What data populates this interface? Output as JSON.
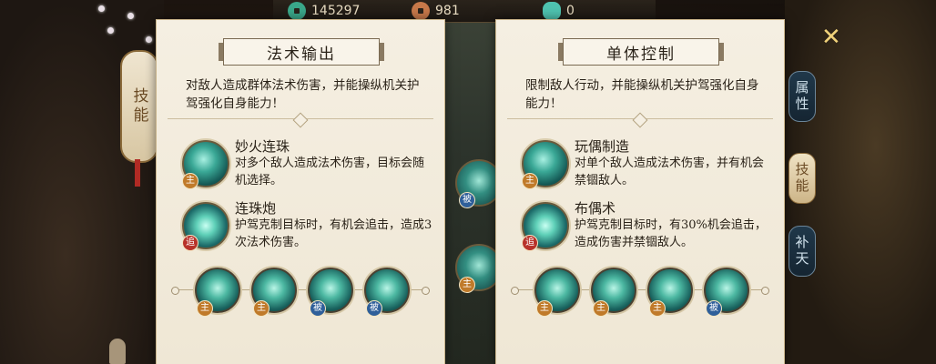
{
  "resources": [
    {
      "icon": "jade-coin-icon",
      "value": "145297",
      "color": "#3aa88a"
    },
    {
      "icon": "copper-coin-icon",
      "value": "981",
      "color": "#c8794a"
    },
    {
      "icon": "gem-icon",
      "value": "0",
      "color": "#4fc3b0"
    }
  ],
  "left_tab_label": "技能",
  "panels": [
    {
      "title": "法术输出",
      "description": "对敌人造成群体法术伤害，并能操纵机关护驾强化自身能力！",
      "skills": [
        {
          "name": "妙火连珠",
          "badge": "主",
          "desc": "对多个敌人造成法术伤害，目标会随机选择。"
        },
        {
          "name": "连珠炮",
          "badge": "追",
          "desc": "护驾克制目标时，有机会追击，造成3次法术伤害。"
        }
      ],
      "bottom_badges": [
        "主",
        "主",
        "被",
        "被"
      ]
    },
    {
      "title": "单体控制",
      "description": "限制敌人行动，并能操纵机关护驾强化自身能力！",
      "skills": [
        {
          "name": "玩偶制造",
          "badge": "主",
          "desc": "对单个敌人造成法术伤害，并有机会禁锢敌人。"
        },
        {
          "name": "布偶术",
          "badge": "追",
          "desc": "护驾克制目标时，有30%机会追击，造成伤害并禁锢敌人。"
        }
      ],
      "bottom_badges": [
        "主",
        "主",
        "主",
        "被"
      ]
    }
  ],
  "middle_badges": [
    "被",
    "主"
  ],
  "right_tabs": [
    "属性",
    "技能",
    "补天"
  ],
  "close_label": "✕"
}
